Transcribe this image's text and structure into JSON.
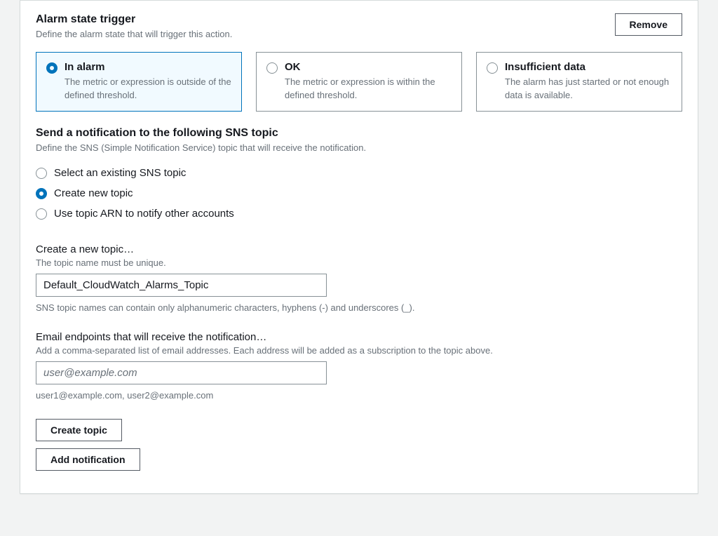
{
  "alarmTrigger": {
    "title": "Alarm state trigger",
    "description": "Define the alarm state that will trigger this action.",
    "removeLabel": "Remove",
    "options": [
      {
        "title": "In alarm",
        "desc": "The metric or expression is outside of the defined threshold.",
        "selected": true
      },
      {
        "title": "OK",
        "desc": "The metric or expression is within the defined threshold.",
        "selected": false
      },
      {
        "title": "Insufficient data",
        "desc": "The alarm has just started or not enough data is available.",
        "selected": false
      }
    ]
  },
  "snsSection": {
    "title": "Send a notification to the following SNS topic",
    "description": "Define the SNS (Simple Notification Service) topic that will receive the notification.",
    "options": [
      {
        "label": "Select an existing SNS topic",
        "selected": false
      },
      {
        "label": "Create new topic",
        "selected": true
      },
      {
        "label": "Use topic ARN to notify other accounts",
        "selected": false
      }
    ]
  },
  "createTopic": {
    "label": "Create a new topic…",
    "hint": "The topic name must be unique.",
    "value": "Default_CloudWatch_Alarms_Topic",
    "footnote": "SNS topic names can contain only alphanumeric characters, hyphens (-) and underscores (_)."
  },
  "emailEndpoints": {
    "label": "Email endpoints that will receive the notification…",
    "hint": "Add a comma-separated list of email addresses. Each address will be added as a subscription to the topic above.",
    "placeholder": "user@example.com",
    "value": "",
    "footnote": "user1@example.com, user2@example.com"
  },
  "buttons": {
    "createTopic": "Create topic",
    "addNotification": "Add notification"
  }
}
